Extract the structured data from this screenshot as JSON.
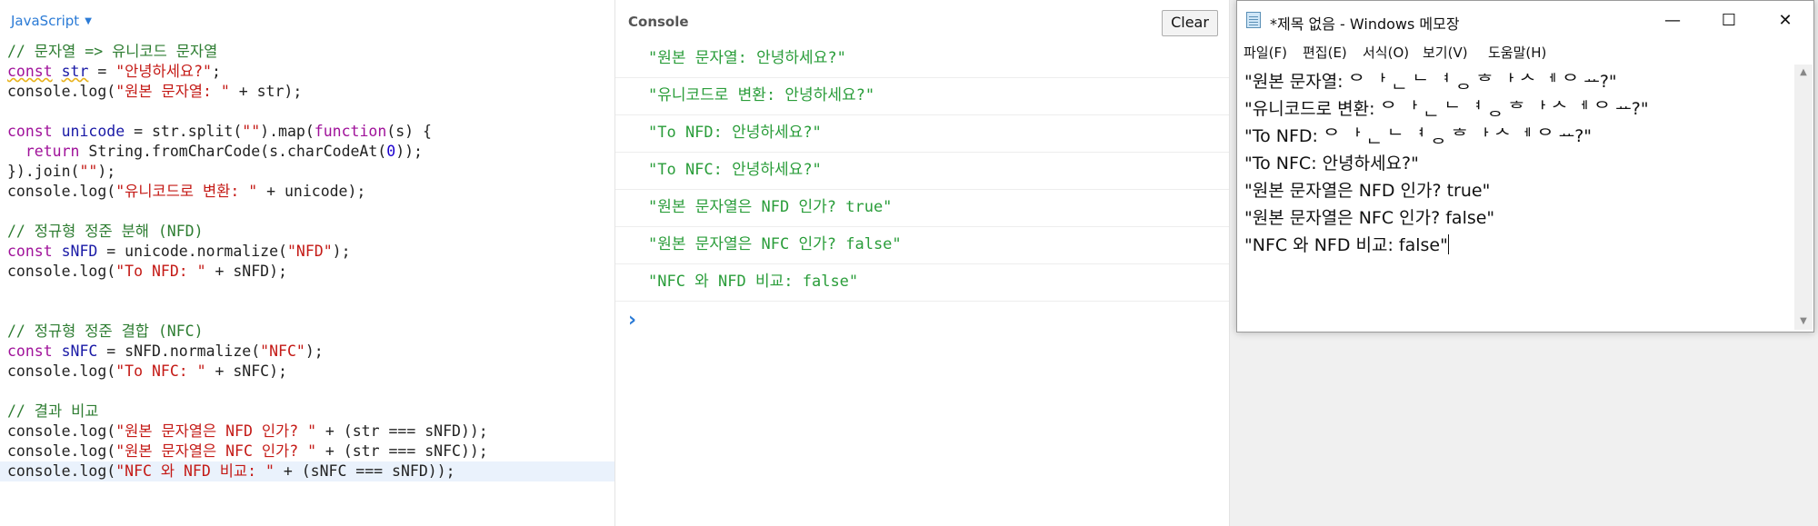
{
  "editor": {
    "language": "JavaScript",
    "lines": [
      {
        "tokens": [
          {
            "t": "// 문자열 => 유니코드 문자열",
            "c": "comment"
          }
        ]
      },
      {
        "tokens": [
          {
            "t": "const",
            "c": "kw ul"
          },
          {
            "t": " ",
            "c": "plain"
          },
          {
            "t": "str",
            "c": "var ul"
          },
          {
            "t": " = ",
            "c": "plain"
          },
          {
            "t": "\"안녕하세요?\"",
            "c": "str"
          },
          {
            "t": ";",
            "c": "plain"
          }
        ]
      },
      {
        "tokens": [
          {
            "t": "console.log(",
            "c": "plain"
          },
          {
            "t": "\"원본 문자열: \"",
            "c": "str"
          },
          {
            "t": " + str);",
            "c": "plain"
          }
        ]
      },
      {
        "tokens": []
      },
      {
        "tokens": [
          {
            "t": "const",
            "c": "kw"
          },
          {
            "t": " ",
            "c": "plain"
          },
          {
            "t": "unicode",
            "c": "var"
          },
          {
            "t": " = str.split(",
            "c": "plain"
          },
          {
            "t": "\"\"",
            "c": "str"
          },
          {
            "t": ").map(",
            "c": "plain"
          },
          {
            "t": "function",
            "c": "kw"
          },
          {
            "t": "(s) {",
            "c": "plain"
          }
        ]
      },
      {
        "tokens": [
          {
            "t": "  ",
            "c": "plain"
          },
          {
            "t": "return",
            "c": "kw"
          },
          {
            "t": " String.fromCharCode(s.charCodeAt(",
            "c": "plain"
          },
          {
            "t": "0",
            "c": "num"
          },
          {
            "t": "));",
            "c": "plain"
          }
        ]
      },
      {
        "tokens": [
          {
            "t": "}).join(",
            "c": "plain"
          },
          {
            "t": "\"\"",
            "c": "str"
          },
          {
            "t": ");",
            "c": "plain"
          }
        ]
      },
      {
        "tokens": [
          {
            "t": "console.log(",
            "c": "plain"
          },
          {
            "t": "\"유니코드로 변환: \"",
            "c": "str"
          },
          {
            "t": " + unicode);",
            "c": "plain"
          }
        ]
      },
      {
        "tokens": []
      },
      {
        "tokens": [
          {
            "t": "// 정규형 정준 분해 (NFD)",
            "c": "comment"
          }
        ]
      },
      {
        "tokens": [
          {
            "t": "const",
            "c": "kw"
          },
          {
            "t": " ",
            "c": "plain"
          },
          {
            "t": "sNFD",
            "c": "var"
          },
          {
            "t": " = unicode.normalize(",
            "c": "plain"
          },
          {
            "t": "\"NFD\"",
            "c": "str"
          },
          {
            "t": ");",
            "c": "plain"
          }
        ]
      },
      {
        "tokens": [
          {
            "t": "console.log(",
            "c": "plain"
          },
          {
            "t": "\"To NFD: \"",
            "c": "str"
          },
          {
            "t": " + sNFD);",
            "c": "plain"
          }
        ]
      },
      {
        "tokens": []
      },
      {
        "tokens": []
      },
      {
        "tokens": [
          {
            "t": "// 정규형 정준 결합 (NFC)",
            "c": "comment"
          }
        ]
      },
      {
        "tokens": [
          {
            "t": "const",
            "c": "kw"
          },
          {
            "t": " ",
            "c": "plain"
          },
          {
            "t": "sNFC",
            "c": "var"
          },
          {
            "t": " = sNFD.normalize(",
            "c": "plain"
          },
          {
            "t": "\"NFC\"",
            "c": "str"
          },
          {
            "t": ");",
            "c": "plain"
          }
        ]
      },
      {
        "tokens": [
          {
            "t": "console.log(",
            "c": "plain"
          },
          {
            "t": "\"To NFC: \"",
            "c": "str"
          },
          {
            "t": " + sNFC);",
            "c": "plain"
          }
        ]
      },
      {
        "tokens": []
      },
      {
        "tokens": [
          {
            "t": "// 결과 비교",
            "c": "comment"
          }
        ]
      },
      {
        "tokens": [
          {
            "t": "console.log(",
            "c": "plain"
          },
          {
            "t": "\"원본 문자열은 NFD 인가? \"",
            "c": "str"
          },
          {
            "t": " + (str === sNFD));",
            "c": "plain"
          }
        ]
      },
      {
        "tokens": [
          {
            "t": "console.log(",
            "c": "plain"
          },
          {
            "t": "\"원본 문자열은 NFC 인가? \"",
            "c": "str"
          },
          {
            "t": " + (str === sNFC));",
            "c": "plain"
          }
        ]
      },
      {
        "tokens": [
          {
            "t": "console.log(",
            "c": "plain"
          },
          {
            "t": "\"NFC 와 NFD 비교: \"",
            "c": "str"
          },
          {
            "t": " + (sNFC === sNFD));",
            "c": "plain"
          }
        ],
        "highlight": true
      }
    ]
  },
  "console": {
    "title": "Console",
    "clear_label": "Clear",
    "entries": [
      "\"원본 문자열: 안녕하세요?\"",
      "\"유니코드로 변환: 안녕하세요?\"",
      "\"To NFD: 안녕하세요?\"",
      "\"To NFC: 안녕하세요?\"",
      "\"원본 문자열은 NFD 인가? true\"",
      "\"원본 문자열은 NFC 인가? false\"",
      "\"NFC 와 NFD 비교: false\""
    ],
    "prompt_icon": "chevron-right-icon"
  },
  "notepad": {
    "title": "*제목 없음 - Windows 메모장",
    "window_buttons": {
      "minimize": "—",
      "maximize": "☐",
      "close": "✕"
    },
    "menu": [
      "파일(F)",
      "편집(E)",
      "서식(O)",
      "보기(V)",
      "도움말(H)"
    ],
    "lines": [
      "\"원본 문자열: ᄋ ᅡ ᆫ ᄂ ᅧ ᆼ ᄒ ᅡ ᄉ ᅦ ᄋ ᅭ?\"",
      "\"유니코드로 변환: ᄋ ᅡ ᆫ ᄂ ᅧ ᆼ ᄒ ᅡ ᄉ ᅦ ᄋ ᅭ?\"",
      "\"To NFD: ᄋ ᅡ ᆫ ᄂ ᅧ ᆼ ᄒ ᅡ ᄉ ᅦ ᄋ ᅭ?\"",
      "\"To NFC: 안녕하세요?\"",
      "\"원본 문자열은 NFD 인가? true\"",
      "\"원본 문자열은 NFC 인가? false\"",
      "\"NFC 와 NFD 비교: false\""
    ]
  }
}
